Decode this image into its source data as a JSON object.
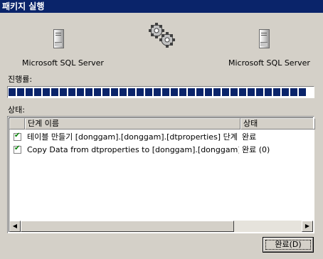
{
  "window": {
    "title": "패키지 실행"
  },
  "source": {
    "label": "Microsoft SQL Server"
  },
  "destination": {
    "label": "Microsoft SQL Server"
  },
  "progress": {
    "label": "진행률:",
    "fraction": 1.0
  },
  "status": {
    "label": "상태:",
    "columns": [
      "",
      "단계 이름",
      "상태"
    ],
    "rows": [
      {
        "checked": true,
        "step": "테이블 만들기 [donggam].[donggam].[dtproperties] 단계",
        "status": "완료"
      },
      {
        "checked": true,
        "step": "Copy Data from dtproperties to [donggam].[donggam].[dtprop...",
        "status": "완료 (0)"
      }
    ]
  },
  "buttons": {
    "done": "완료(D)"
  },
  "icons": {
    "source": "server-icon",
    "destination": "server-icon",
    "transfer": "gears-icon"
  },
  "colors": {
    "titlebar": "#0a246a",
    "progress_fill": "#0a246a",
    "check": "#008000"
  }
}
